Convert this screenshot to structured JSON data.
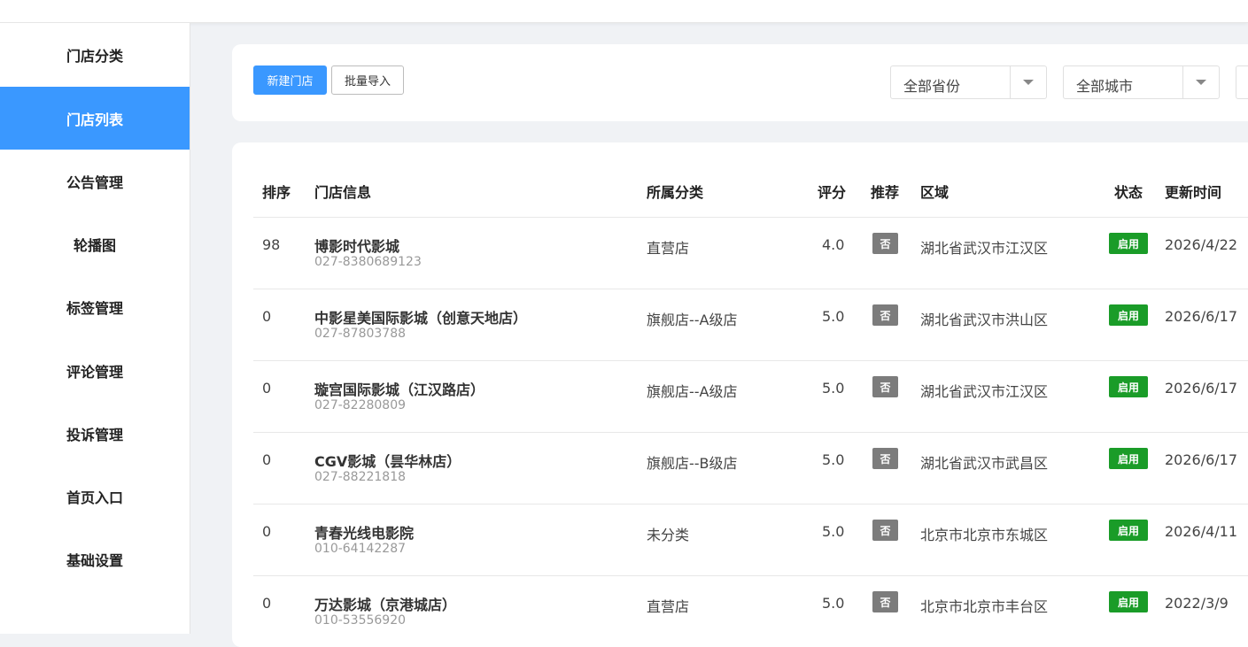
{
  "sidebar": {
    "items": [
      {
        "label": "门店分类",
        "active": false
      },
      {
        "label": "门店列表",
        "active": true
      },
      {
        "label": "公告管理",
        "active": false
      },
      {
        "label": "轮播图",
        "active": false
      },
      {
        "label": "标签管理",
        "active": false
      },
      {
        "label": "评论管理",
        "active": false
      },
      {
        "label": "投诉管理",
        "active": false
      },
      {
        "label": "首页入口",
        "active": false
      },
      {
        "label": "基础设置",
        "active": false
      }
    ]
  },
  "toolbar": {
    "new_store_label": "新建门店",
    "import_label": "批量导入",
    "province_select": "全部省份",
    "city_select": "全部城市"
  },
  "table": {
    "headers": {
      "sort": "排序",
      "info": "门店信息",
      "category": "所属分类",
      "score": "评分",
      "recommend": "推荐",
      "region": "区域",
      "status": "状态",
      "updated": "更新时间"
    },
    "rows": [
      {
        "sort": "98",
        "name": "博影时代影城",
        "phone": "027-8380689123",
        "category": "直营店",
        "score": "4.0",
        "recommend": "否",
        "region": "湖北省武汉市江汉区",
        "status": "启用",
        "updated": "2026/4/22"
      },
      {
        "sort": "0",
        "name": "中影星美国际影城（创意天地店）",
        "phone": "027-87803788",
        "category": "旗舰店--A级店",
        "score": "5.0",
        "recommend": "否",
        "region": "湖北省武汉市洪山区",
        "status": "启用",
        "updated": "2026/6/17"
      },
      {
        "sort": "0",
        "name": "璇宫国际影城（江汉路店）",
        "phone": "027-82280809",
        "category": "旗舰店--A级店",
        "score": "5.0",
        "recommend": "否",
        "region": "湖北省武汉市江汉区",
        "status": "启用",
        "updated": "2026/6/17"
      },
      {
        "sort": "0",
        "name": "CGV影城（昙华林店）",
        "phone": "027-88221818",
        "category": "旗舰店--B级店",
        "score": "5.0",
        "recommend": "否",
        "region": "湖北省武汉市武昌区",
        "status": "启用",
        "updated": "2026/6/17"
      },
      {
        "sort": "0",
        "name": "青春光线电影院",
        "phone": "010-64142287",
        "category": "未分类",
        "score": "5.0",
        "recommend": "否",
        "region": "北京市北京市东城区",
        "status": "启用",
        "updated": "2026/4/11"
      },
      {
        "sort": "0",
        "name": "万达影城（京港城店）",
        "phone": "010-53556920",
        "category": "直营店",
        "score": "5.0",
        "recommend": "否",
        "region": "北京市北京市丰台区",
        "status": "启用",
        "updated": "2022/3/9"
      }
    ]
  },
  "colors": {
    "primary": "#3a98ff",
    "status_green": "#1a9c28",
    "tag_gray": "#7c7c7c",
    "page_bg": "#f0f2f5"
  }
}
